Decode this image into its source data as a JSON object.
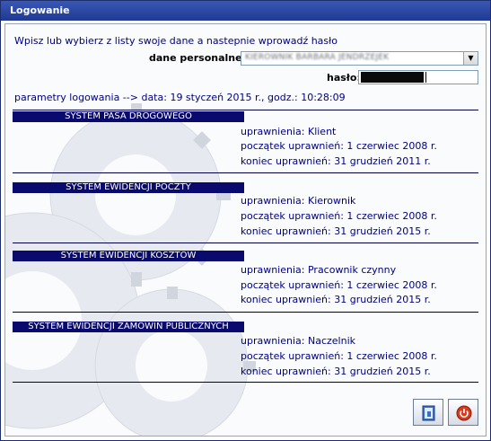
{
  "window": {
    "title": "Logowanie"
  },
  "instruction": "Wpisz lub wybierz z listy swoje dane a nastepnie wprowadź hasło",
  "fields": {
    "personal_label": "dane personalne:",
    "personal_value": "KIEROWNIK BARBARA JENDRZEJEK",
    "password_label": "hasło:"
  },
  "login_params": "parametry logowania --> data: 19 styczeń 2015 r., godz.: 10:28:09",
  "systems": [
    {
      "name": "SYSTEM PASA DROGOWEGO",
      "rights": "uprawnienia: Klient",
      "start": "początek uprawnień: 1 czerwiec 2008 r.",
      "end": "koniec uprawnień: 31 grudzień 2011 r."
    },
    {
      "name": "SYSTEM EWIDENCJI POCZTY",
      "rights": "uprawnienia: Kierownik",
      "start": "początek uprawnień: 1 czerwiec 2008 r.",
      "end": "koniec uprawnień: 31 grudzień 2015 r."
    },
    {
      "name": "SYSTEM EWIDENCJI KOSZTÓW",
      "rights": "uprawnienia: Pracownik czynny",
      "start": "początek uprawnień: 1 czerwiec 2008 r.",
      "end": "koniec uprawnień: 31 grudzień 2015 r."
    },
    {
      "name": "SYSTEM EWIDENCJI ZAMÓWIŃ PUBLICZNYCH",
      "rights": "uprawnienia: Naczelnik",
      "start": "początek uprawnień: 1 czerwiec 2008 r.",
      "end": "koniec uprawnień: 31 grudzień 2015 r."
    }
  ],
  "buttons": {
    "login_icon": "login-door-icon",
    "exit_icon": "power-off-icon"
  },
  "colors": {
    "title_bar": "#2a45a0",
    "section_header": "#0a0a6e",
    "text": "#000080",
    "exit_red": "#d83a1e"
  }
}
